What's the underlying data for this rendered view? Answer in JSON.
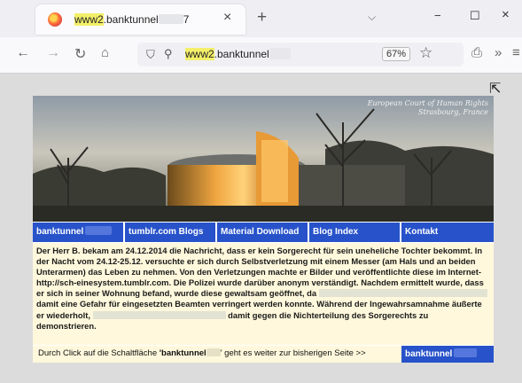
{
  "browser": {
    "tab": {
      "title_prefix": "www2",
      "title_rest": ".banktunnel",
      "title_tail": "7"
    },
    "window": {
      "minimize": "−",
      "maximize": "☐",
      "close": "×"
    },
    "nav": {
      "url_highlight": "www2",
      "url_rest": ".banktunnel",
      "zoom": "67%"
    }
  },
  "site": {
    "hero_caption_line1": "European Court of Human Rights",
    "hero_caption_line2": "Strasbourg, France",
    "nav_items": [
      "banktunnel",
      "tumblr.com Blogs",
      "Material Download",
      "Blog Index",
      "Kontakt"
    ],
    "body": {
      "p1": "Der Herr B. bekam am 24.12.2014 die Nachricht, dass er kein Sorgerecht für sein uneheliche Tochter bekommt. In der Nacht vom 24.12-25.12. versuchte er sich durch Selbstverletzung mit einem Messer (am Hals und an beiden Unterarmen) das Leben zu nehmen. Von den Verletzungen machte er Bilder und veröffentlichte diese im Internet- http://sch-einesystem.tumblr.com. Die Polizei wurde darüber anonym verständigt. Nachdem ermittelt wurde, dass er sich in seiner Wohnung befand, wurde diese gewaltsam geöffnet, da",
      "p2": "damit eine Gefahr für eingesetzten Beamten verringert werden konnte. Während der Ingewahrsamnahme äußerte er wiederholt,",
      "p3": "damit gegen die Nichterteilung des Sorgerechts zu demonstrieren."
    },
    "footer": {
      "text_before": "Durch Click auf die Schaltfläche ",
      "button_name": "'banktunnel",
      "text_after": "' geht es weiter zur bisherigen Seite >>",
      "button_label": "banktunnel"
    }
  },
  "icons": [
    "firefox-icon",
    "close-icon",
    "plus-icon",
    "chevron-down-icon",
    "back-icon",
    "forward-icon",
    "reload-icon",
    "home-icon",
    "shield-icon",
    "lock-icon",
    "star-icon",
    "extensions-icon",
    "more-tools-icon",
    "menu-icon",
    "cursor-icon"
  ]
}
